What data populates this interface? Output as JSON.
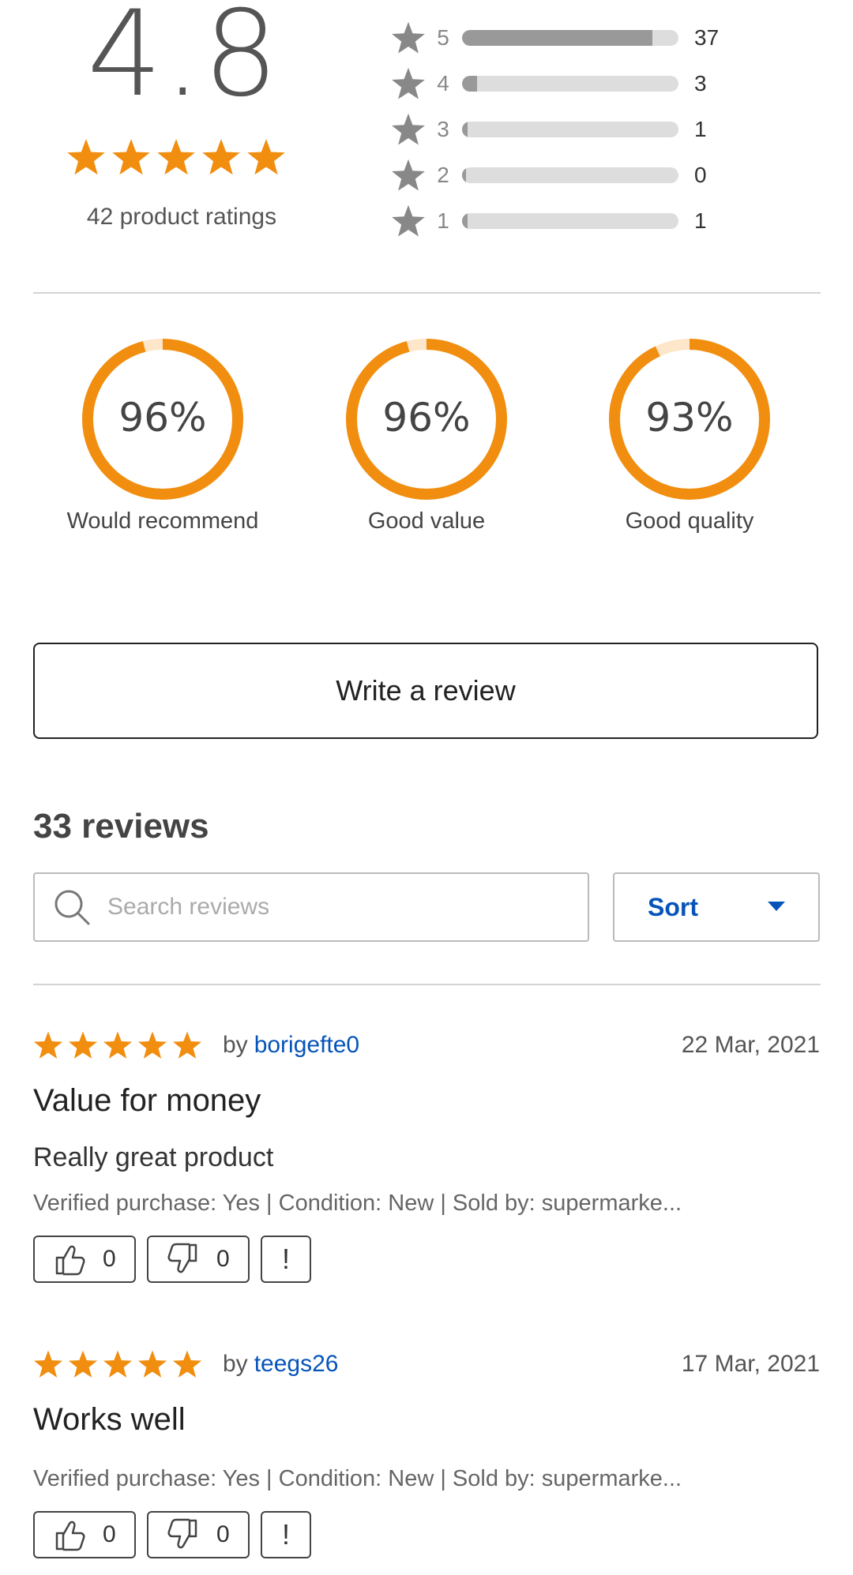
{
  "summary": {
    "average_score": "4.8",
    "stars_filled": 5,
    "ratings_count_text": "42 product ratings",
    "distribution": [
      {
        "star": "5",
        "count": "37",
        "fraction": 0.881
      },
      {
        "star": "4",
        "count": "3",
        "fraction": 0.071
      },
      {
        "star": "3",
        "count": "1",
        "fraction": 0.024
      },
      {
        "star": "2",
        "count": "0",
        "fraction": 0.0
      },
      {
        "star": "1",
        "count": "1",
        "fraction": 0.024
      }
    ]
  },
  "metrics": [
    {
      "value_text": "96%",
      "percent": 96,
      "label": "Would recommend"
    },
    {
      "value_text": "96%",
      "percent": 96,
      "label": "Good value"
    },
    {
      "value_text": "93%",
      "percent": 93,
      "label": "Good quality"
    }
  ],
  "write_review_label": "Write a review",
  "reviews_header": "33 reviews",
  "search": {
    "placeholder": "Search reviews",
    "value": ""
  },
  "sort_label": "Sort",
  "reviews": [
    {
      "stars": 5,
      "by_prefix": "by",
      "username": "borigefte0",
      "date": "22 Mar, 2021",
      "title": "Value for money",
      "body": "Really great product",
      "meta": "Verified purchase:  Yes | Condition: New | Sold by: supermarke...",
      "helpful_count": "0",
      "unhelpful_count": "0",
      "report_label": "!"
    },
    {
      "stars": 5,
      "by_prefix": "by",
      "username": "teegs26",
      "date": "17 Mar, 2021",
      "title": "Works well",
      "body": "",
      "meta": "Verified purchase:  Yes | Condition: New | Sold by: supermarke...",
      "helpful_count": "0",
      "unhelpful_count": "0",
      "report_label": "!"
    }
  ],
  "colors": {
    "accent_orange": "#f18e0f",
    "ring_track": "#fde6c9",
    "link_blue": "#0654ba",
    "bar_fill": "#999999",
    "bar_track": "#dddddd",
    "grey_star": "#888888"
  },
  "icons": {
    "star": "star-icon",
    "search": "search-icon",
    "caret": "caret-down-icon",
    "thumb_up": "thumbs-up-icon",
    "thumb_down": "thumbs-down-icon",
    "report": "report-icon"
  }
}
